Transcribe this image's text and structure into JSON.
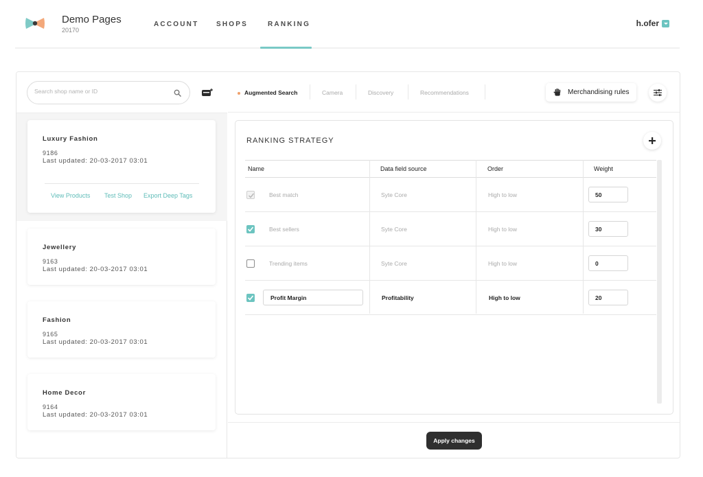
{
  "header": {
    "brand_name": "Demo Pages",
    "brand_id": "20170",
    "nav": [
      {
        "label": "ACCOUNT",
        "active": false
      },
      {
        "label": "SHOPS",
        "active": false
      },
      {
        "label": "RANKING",
        "active": true
      }
    ],
    "user": "h.ofer",
    "icons": {
      "logo": "bowtie-logo-icon",
      "user_menu": "caret-down-icon"
    }
  },
  "sidebar": {
    "search_placeholder": "Search shop name or ID",
    "icons": {
      "search": "search-icon",
      "add_shop": "add-shop-icon"
    },
    "shops": [
      {
        "name": "Luxury Fashion",
        "id": "9186",
        "updated": "Last updated: 20-03-2017 03:01",
        "selected": true,
        "links": [
          "View Products",
          "Test Shop",
          "Export Deep Tags"
        ]
      },
      {
        "name": "Jewellery",
        "id": "9163",
        "updated": "Last updated: 20-03-2017 03:01",
        "selected": false
      },
      {
        "name": "Fashion",
        "id": "9165",
        "updated": "Last updated: 20-03-2017 03:01",
        "selected": false
      },
      {
        "name": "Home Decor",
        "id": "9164",
        "updated": "Last updated: 20-03-2017 03:01",
        "selected": false
      }
    ]
  },
  "tabs": [
    {
      "label": "Augmented Search",
      "active": true
    },
    {
      "label": "Camera",
      "active": false
    },
    {
      "label": "Discovery",
      "active": false
    },
    {
      "label": "Recommendations",
      "active": false
    }
  ],
  "toolbar": {
    "merchandising_label": "Merchandising rules",
    "icons": {
      "merchandising": "hand-icon",
      "filters": "sliders-icon"
    }
  },
  "strategy": {
    "title": "RANKING STRATEGY",
    "add_icon": "plus-icon",
    "columns": [
      "Name",
      "Data field source",
      "Order",
      "Weight"
    ],
    "rows": [
      {
        "name": "Best match",
        "source": "Syte Core",
        "order": "High to low",
        "weight": "50",
        "checked": true,
        "disabled": true,
        "editable": false
      },
      {
        "name": "Best sellers",
        "source": "Syte Core",
        "order": "High to low",
        "weight": "30",
        "checked": true,
        "disabled": false,
        "editable": false
      },
      {
        "name": "Trending items",
        "source": "Syte Core",
        "order": "High to low",
        "weight": "0",
        "checked": false,
        "disabled": false,
        "editable": false
      },
      {
        "name": "Profit Margin",
        "source": "Profitability",
        "order": "High to low",
        "weight": "20",
        "checked": true,
        "disabled": false,
        "editable": true
      }
    ]
  },
  "footer": {
    "apply_label": "Apply changes"
  },
  "colors": {
    "accent": "#6cc4c0",
    "tab_dot": "#f0a06a",
    "dark_button": "#2f2f2f"
  }
}
